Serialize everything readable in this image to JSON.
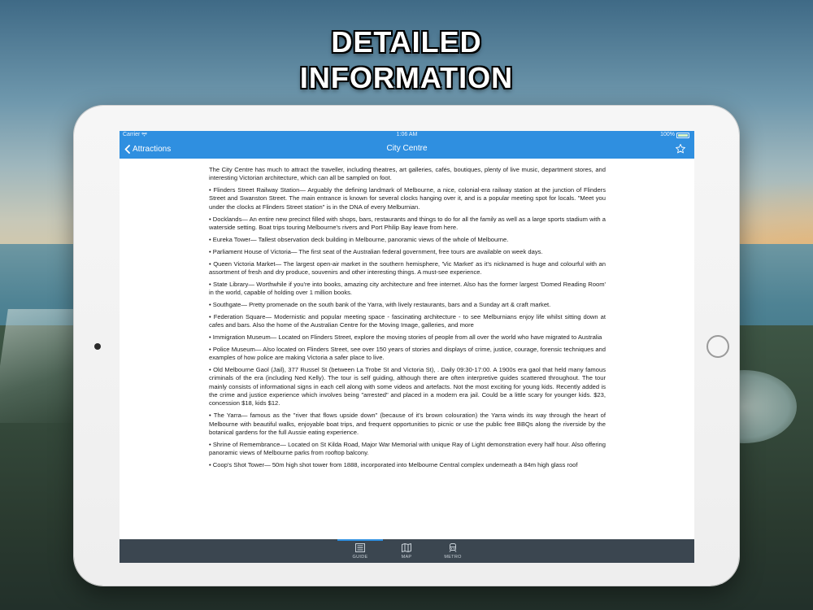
{
  "headline": {
    "line1": "DETAILED",
    "line2": "INFORMATION"
  },
  "status_bar": {
    "carrier": "Carrier",
    "wifi_icon": "wifi-icon",
    "time": "1:06 AM",
    "battery": "100%"
  },
  "nav": {
    "back_label": "Attractions",
    "title": "City Centre",
    "favorite_icon": "star-icon"
  },
  "content": {
    "paragraphs": [
      "The City Centre has much to attract the traveller, including theatres, art galleries, cafés, boutiques, plenty of live music, department stores, and interesting Victorian architecture, which can all be sampled on foot.",
      "• Flinders Street Railway Station— Arguably the defining landmark of Melbourne, a nice, colonial-era railway station at the junction of Flinders Street and Swanston Street. The main entrance is known for several clocks hanging over it, and is a popular meeting spot for locals. \"Meet you under the clocks at Flinders Street station\" is in the DNA of every Melburnian.",
      "• Docklands— An entire new precinct filled with shops, bars, restaurants and things to do for all the family as well as a large sports stadium with a waterside setting. Boat trips touring Melbourne's rivers and Port Philip Bay leave from here.",
      "• Eureka Tower— Tallest observation deck building in Melbourne, panoramic views of the whole of Melbourne.",
      "• Parliament House of Victoria— The first seat of the Australian federal government, free tours are available on week days.",
      "• Queen Victoria Market— The largest open-air market in the southern hemisphere, 'Vic Market' as it's nicknamed is huge and colourful with an assortment of fresh and dry produce, souvenirs and other interesting things. A must-see experience.",
      "• State Library— Worthwhile if you're into books, amazing city architecture and free internet. Also has the former largest 'Domed Reading Room' in the world, capable of holding over 1 million books.",
      "• Southgate— Pretty promenade on the south bank of the Yarra, with lively restaurants, bars and a Sunday art & craft market.",
      "• Federation Square— Modernistic and popular meeting space - fascinating architecture - to see Melburnians enjoy life whilst sitting down at cafes and bars. Also the home of the Australian Centre for the Moving Image, galleries, and more",
      "• Immigration Museum— Located on Flinders Street, explore the moving stories of people from all over the world who have migrated to Australia",
      "• Police Museum— Also located on Flinders Street, see over 150 years of stories and displays of crime, justice, courage, forensic techniques and examples of how police are making Victoria a safer place to live.",
      "• Old Melbourne Gaol (Jail), 377 Russel St (between La Trobe St and Victoria St), . Daily 09:30-17:00. A 1900s era gaol that held many famous criminals of the era (including Ned Kelly). The tour is self guiding, although there are often interpretive guides scattered throughout. The tour mainly consists of informational signs in each cell along with some videos and artefacts. Not the most exciting for young kids. Recently added is the crime and justice experience which involves being \"arrested\" and placed in a modern era jail. Could be a little scary for younger kids. $23, concession $18, kids $12.",
      "• The Yarra— famous as the \"river that flows upside down\" (because of it's brown colouration) the Yarra winds its way through the heart of Melbourne with beautiful walks, enjoyable boat trips, and frequent opportunities to picnic or use the public free BBQs along the riverside by the botanical gardens for the full Aussie eating experience.",
      "• Shrine of Remembrance— Located on St Kilda Road, Major War Memorial with unique Ray of Light demonstration every half hour. Also offering panoramic views of Melbourne parks from rooftop balcony.",
      "• Coop's Shot Tower— 50m high shot tower from 1888, incorporated into Melbourne Central complex underneath a 84m high glass roof"
    ]
  },
  "tabs": [
    {
      "label": "GUIDE",
      "icon": "guide-list-icon",
      "selected": true
    },
    {
      "label": "MAP",
      "icon": "map-icon",
      "selected": false
    },
    {
      "label": "METRO",
      "icon": "metro-train-icon",
      "selected": false
    }
  ],
  "colors": {
    "accent": "#2f8fe0",
    "tab_bar": "#3b4650"
  }
}
